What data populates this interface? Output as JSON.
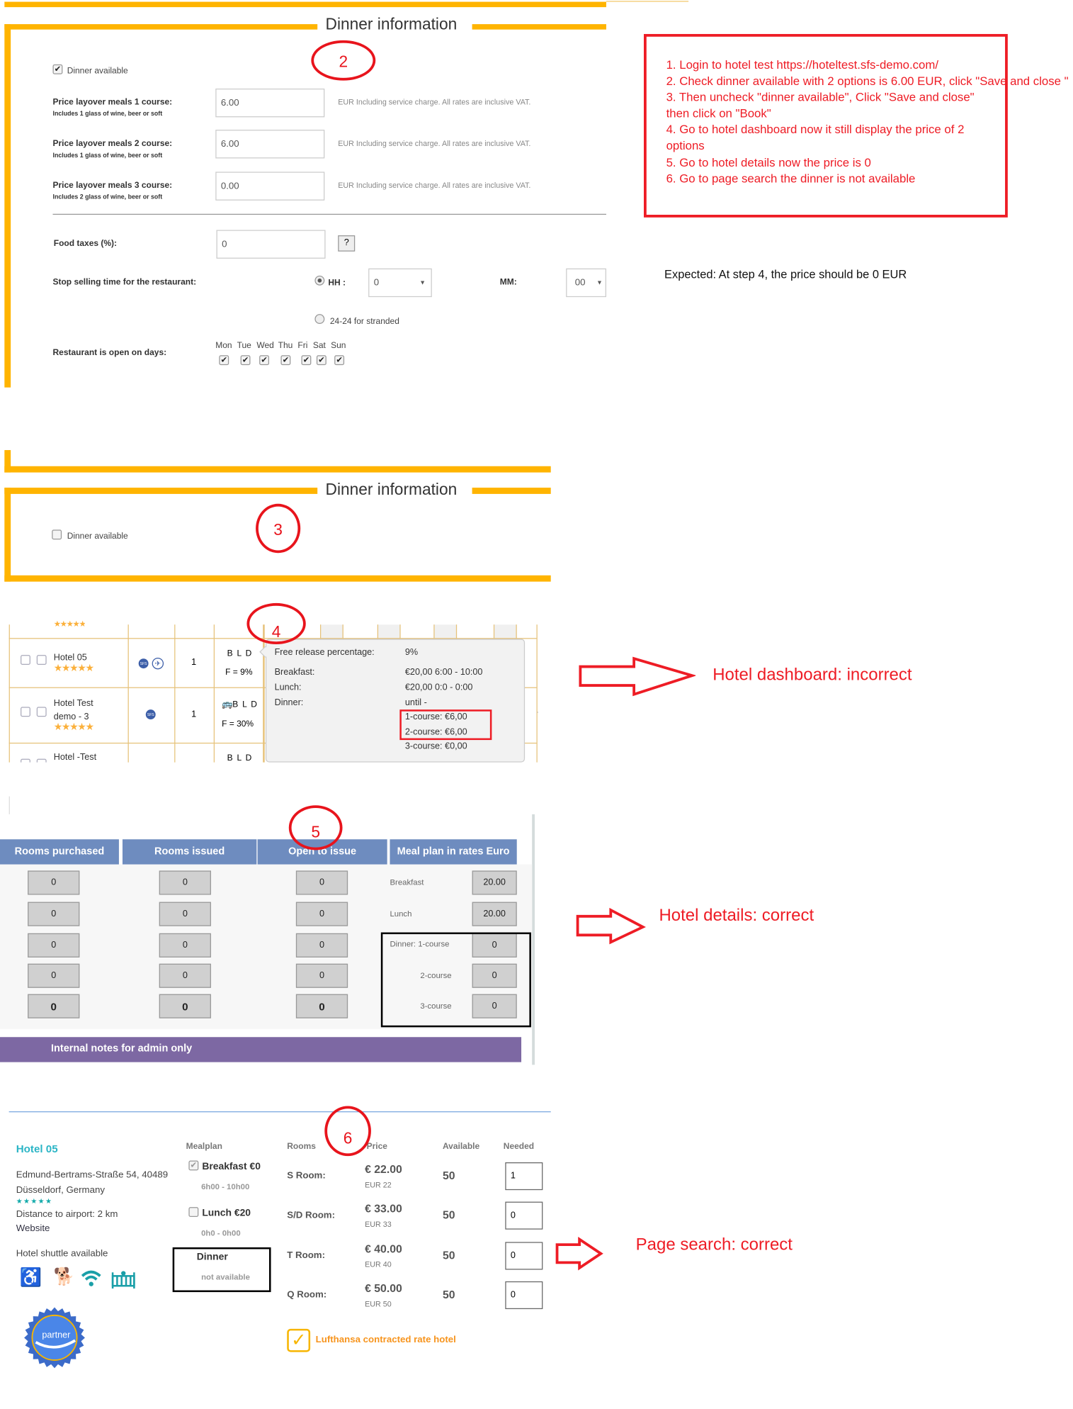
{
  "colors": {
    "accent_yellow": "#ffb400",
    "annotation_red": "#ee1c25",
    "header_blue": "#6e8cbf",
    "notes_purple": "#7d68a3",
    "teal": "#2bb5c6",
    "orange": "#f7941d"
  },
  "step2": {
    "section_title": "Dinner information",
    "step_number": "2",
    "dinner_available_label": "Dinner available",
    "dinner_available_checked": true,
    "prices": [
      {
        "label": "Price layover meals 1 course:",
        "sub": "Includes 1 glass of wine, beer or soft",
        "value": "6.00",
        "note": "EUR Including service charge. All rates are inclusive VAT."
      },
      {
        "label": "Price layover meals 2 course:",
        "sub": "Includes 1 glass of wine, beer or soft",
        "value": "6.00",
        "note": "EUR Including service charge. All rates are inclusive VAT."
      },
      {
        "label": "Price layover meals 3 course:",
        "sub": "Includes 2 glass of wine, beer or soft",
        "value": "0.00",
        "note": "EUR Including service charge. All rates are inclusive VAT."
      }
    ],
    "food_taxes_label": "Food taxes (%):",
    "food_taxes_value": "0",
    "help_label": "?",
    "stop_selling_label": "Stop selling time for the restaurant:",
    "hh_label": "HH :",
    "hh_value": "0",
    "mm_label": "MM:",
    "mm_value": "00",
    "stranded_label": "24-24 for stranded",
    "open_days_label": "Restaurant is open on days:",
    "days": [
      "Mon",
      "Tue",
      "Wed",
      "Thu",
      "Fri",
      "Sat",
      "Sun"
    ],
    "days_checked": [
      true,
      true,
      true,
      true,
      true,
      true,
      true
    ]
  },
  "steps_box": {
    "lines": [
      "1. Login to hotel test https://hoteltest.sfs-demo.com/",
      "2. Check dinner available with 2 options is 6.00 EUR, click \"Save and close \"",
      "3. Then uncheck \"dinner available\", Click \"Save and close\"",
      "then  click on \"Book\"",
      "4. Go to hotel dashboard now it still display the price of 2",
      "options",
      "5. Go to hotel details now the price is 0",
      "6. Go to page search the dinner is not available"
    ],
    "expected": "Expected: At step 4, the price should be 0 EUR"
  },
  "step3": {
    "section_title": "Dinner information",
    "step_number": "3",
    "dinner_available_label": "Dinner available",
    "dinner_available_checked": false
  },
  "step4": {
    "step_number": "4",
    "rows": [
      {
        "name": "Hotel 05",
        "count": "1",
        "meals": "B L D",
        "free": "F = 9%"
      },
      {
        "name_line1": "Hotel Test",
        "name_line2": "demo - 3",
        "count": "1",
        "meals": "B L D",
        "free": "F = 30%"
      },
      {
        "name": "Hotel -Test",
        "meals": "B L D"
      }
    ],
    "tooltip": {
      "free_release_label": "Free release percentage:",
      "free_release_value": "9%",
      "breakfast_label": "Breakfast:",
      "breakfast_value": "€20,00 6:00 - 10:00",
      "lunch_label": "Lunch:",
      "lunch_value": "€20,00 0:0 - 0:00",
      "dinner_label": "Dinner:",
      "dinner_value": "until -",
      "course1": "1-course: €6,00",
      "course2": "2-course: €6,00",
      "course3": "3-course: €0,00"
    },
    "verdict": "Hotel dashboard: incorrect"
  },
  "step5": {
    "step_number": "5",
    "headers": [
      "Rooms purchased",
      "Rooms issued",
      "Open to issue",
      "Meal plan in rates Euro"
    ],
    "cells": "0",
    "meals": [
      {
        "label": "Breakfast",
        "value": "20.00"
      },
      {
        "label": "Lunch",
        "value": "20.00"
      },
      {
        "label": "Dinner: 1-course",
        "value": "0"
      },
      {
        "label": "2-course",
        "value": "0"
      },
      {
        "label": "3-course",
        "value": "0"
      }
    ],
    "notes_label": "Internal notes for admin only",
    "verdict": "Hotel details: correct"
  },
  "step6": {
    "step_number": "6",
    "hotel_name": "Hotel 05",
    "address_line1": "Edmund-Bertrams-Straße 54, 40489",
    "address_line2": "Düsseldorf, Germany",
    "stars": "★★★★★",
    "distance": "Distance to airport: 2 km",
    "website": "Website",
    "shuttle": "Hotel shuttle available",
    "badge": "partner",
    "headers": {
      "mealplan": "Mealplan",
      "rooms": "Rooms",
      "price": "Price",
      "available": "Available",
      "needed": "Needed"
    },
    "meals": [
      {
        "label": "Breakfast €0",
        "time": "6h00 - 10h00",
        "checked": true
      },
      {
        "label": "Lunch €20",
        "time": "0h0 - 0h00",
        "checked": false
      }
    ],
    "dinner_label": "Dinner",
    "dinner_status": "not available",
    "rooms": [
      {
        "name": "S Room:",
        "price": "€ 22.00",
        "eur": "EUR 22",
        "available": "50",
        "needed": "1"
      },
      {
        "name": "S/D Room:",
        "price": "€ 33.00",
        "eur": "EUR 33",
        "available": "50",
        "needed": "0"
      },
      {
        "name": "T Room:",
        "price": "€ 40.00",
        "eur": "EUR 40",
        "available": "50",
        "needed": "0"
      },
      {
        "name": "Q Room:",
        "price": "€ 50.00",
        "eur": "EUR 50",
        "available": "50",
        "needed": "0"
      }
    ],
    "lufthansa": "Lufthansa contracted rate hotel",
    "verdict": "Page search: correct"
  }
}
